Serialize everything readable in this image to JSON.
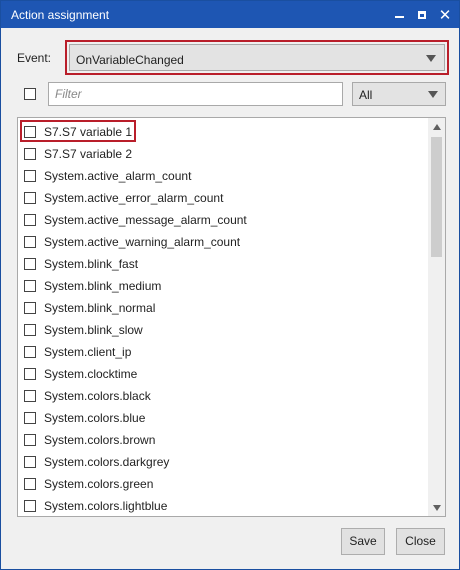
{
  "window": {
    "title": "Action assignment"
  },
  "event": {
    "label": "Event:",
    "selected": "OnVariableChanged"
  },
  "filter": {
    "placeholder": "Filter",
    "value": "",
    "scope": "All",
    "select_all_checked": false
  },
  "items": [
    {
      "label": "S7.S7 variable 1",
      "checked": false,
      "highlighted": true
    },
    {
      "label": "S7.S7 variable 2",
      "checked": false
    },
    {
      "label": "System.active_alarm_count",
      "checked": false
    },
    {
      "label": "System.active_error_alarm_count",
      "checked": false
    },
    {
      "label": "System.active_message_alarm_count",
      "checked": false
    },
    {
      "label": "System.active_warning_alarm_count",
      "checked": false
    },
    {
      "label": "System.blink_fast",
      "checked": false
    },
    {
      "label": "System.blink_medium",
      "checked": false
    },
    {
      "label": "System.blink_normal",
      "checked": false
    },
    {
      "label": "System.blink_slow",
      "checked": false
    },
    {
      "label": "System.client_ip",
      "checked": false
    },
    {
      "label": "System.clocktime",
      "checked": false
    },
    {
      "label": "System.colors.black",
      "checked": false
    },
    {
      "label": "System.colors.blue",
      "checked": false
    },
    {
      "label": "System.colors.brown",
      "checked": false
    },
    {
      "label": "System.colors.darkgrey",
      "checked": false
    },
    {
      "label": "System.colors.green",
      "checked": false
    },
    {
      "label": "System.colors.lightblue",
      "checked": false
    }
  ],
  "buttons": {
    "save": "Save",
    "close": "Close"
  },
  "icons": {
    "minimize": "minimize-icon",
    "maximize": "maximize-icon",
    "close": "close-icon",
    "dropdown": "chevron-down-icon"
  },
  "colors": {
    "titlebar": "#1e56b3",
    "highlight_border": "#b91e2a"
  }
}
